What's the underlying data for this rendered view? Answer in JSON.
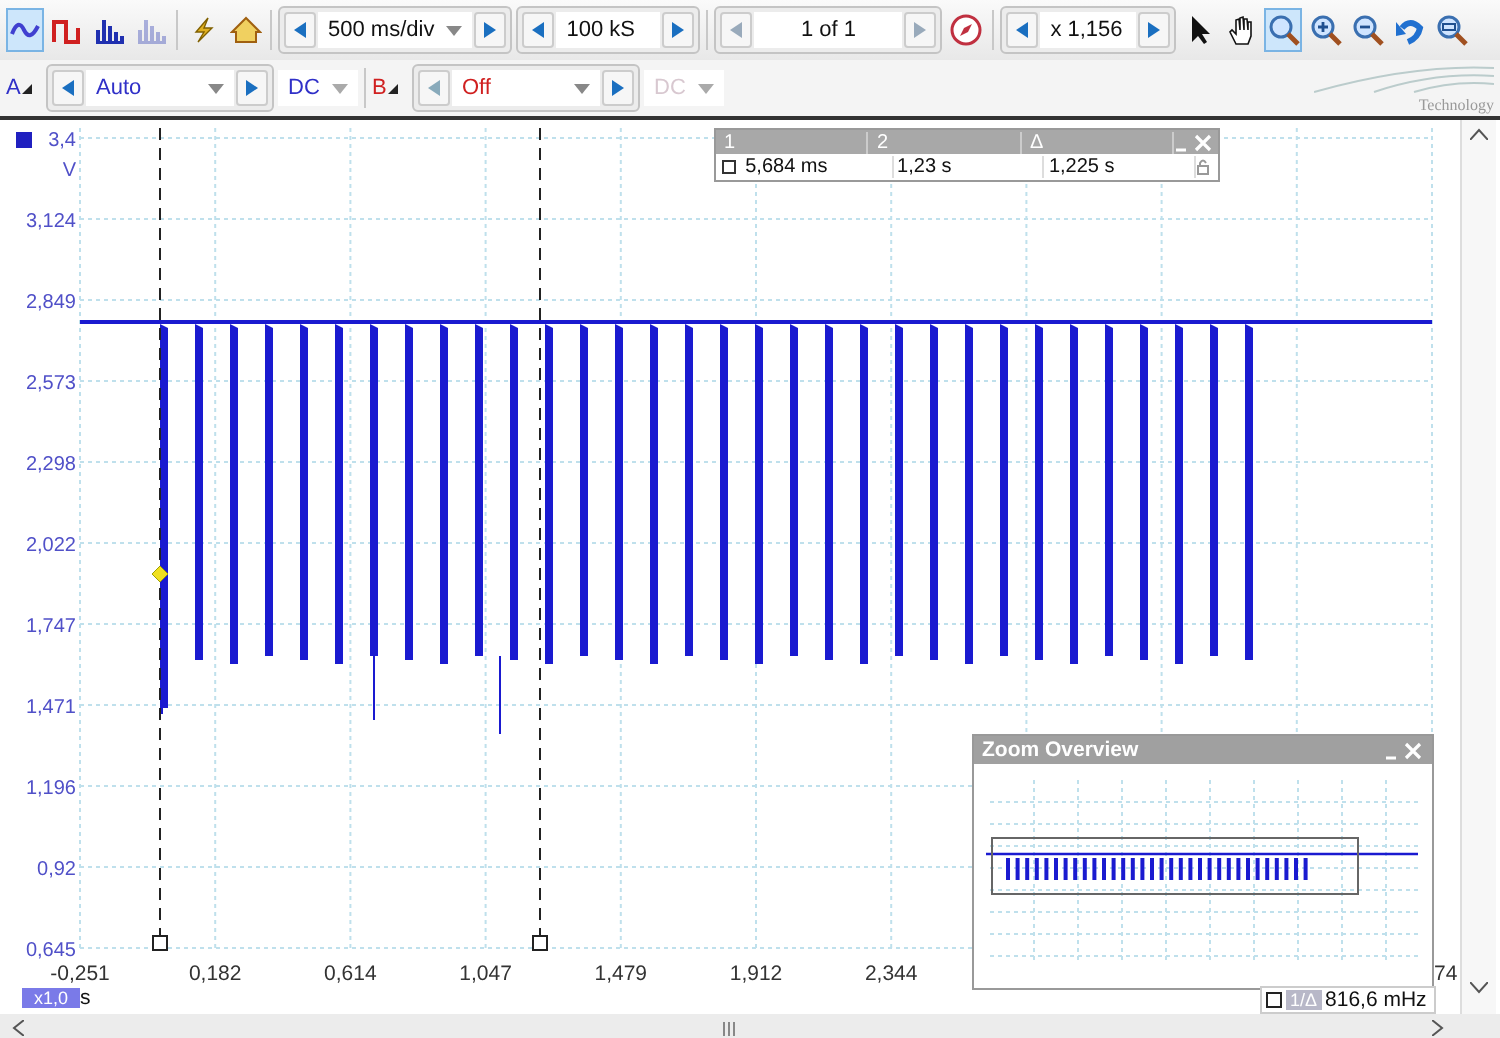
{
  "toolbar": {
    "modes": [
      {
        "kind": "scope",
        "selected": true,
        "disabled": false
      },
      {
        "kind": "persistence",
        "selected": false,
        "disabled": false
      },
      {
        "kind": "spectrum",
        "selected": false,
        "disabled": false
      },
      {
        "kind": "spectrum",
        "selected": false,
        "disabled": true
      },
      {
        "kind": "lightning",
        "selected": false,
        "disabled": false
      },
      {
        "kind": "home",
        "selected": false,
        "disabled": false
      }
    ],
    "timebase": "500 ms/div",
    "samples": "100 kS",
    "buffer": "1 of 1",
    "zoom": "x 1,156",
    "tools": [
      {
        "kind": "pointer",
        "selected": false
      },
      {
        "kind": "hand",
        "selected": false
      },
      {
        "kind": "zoom-region",
        "selected": true
      },
      {
        "kind": "zoom-in",
        "selected": false
      },
      {
        "kind": "zoom-out",
        "selected": false
      },
      {
        "kind": "undo",
        "selected": false
      },
      {
        "kind": "zoom-fit",
        "selected": false
      }
    ]
  },
  "channels": [
    {
      "label": "A",
      "range": "Auto",
      "coupling": "DC",
      "color": "#3030c8",
      "enabled": true
    },
    {
      "label": "B",
      "range": "Off",
      "coupling": "DC",
      "color": "#d02020",
      "enabled": false
    }
  ],
  "logo": {
    "text": "Technology"
  },
  "plot": {
    "y_unit": "V",
    "y_labels": [
      "3,4",
      "3,124",
      "2,849",
      "2,573",
      "2,298",
      "2,022",
      "1,747",
      "1,471",
      "1,196",
      "0,92",
      "0,645"
    ],
    "x_labels": [
      "-0,251",
      "0,182",
      "0,614",
      "1,047",
      "1,479",
      "1,912",
      "2,344"
    ],
    "x_label_edge": "74",
    "x_scale": "x1,0",
    "x_unit": "s"
  },
  "measurements": {
    "headers": [
      "1",
      "2",
      "Δ"
    ],
    "values": [
      "5,684 ms",
      "1,23 s",
      "1,225 s"
    ]
  },
  "zoom_overview": {
    "title": "Zoom Overview"
  },
  "readout": {
    "mode": "1/Δ",
    "value": "816,6 mHz"
  }
}
